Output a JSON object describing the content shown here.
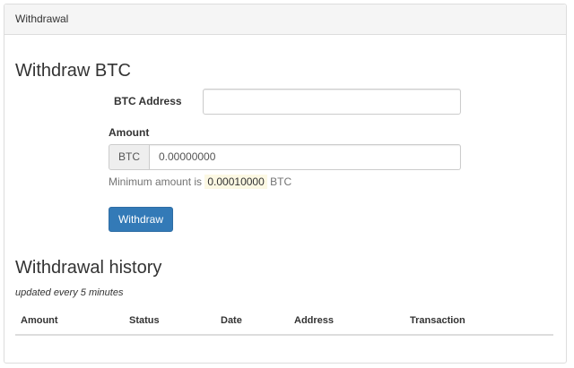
{
  "panel": {
    "heading": "Withdrawal"
  },
  "withdraw": {
    "title": "Withdraw BTC",
    "address_label": "BTC Address",
    "address_value": "",
    "amount_label": "Amount",
    "currency_addon": "BTC",
    "amount_value": "0.00000000",
    "min_prefix": "Minimum amount is",
    "min_amount": "0.00010000",
    "min_suffix": "BTC",
    "submit_label": "Withdraw"
  },
  "history": {
    "title": "Withdrawal history",
    "subtitle": "updated every 5 minutes",
    "columns": [
      "Amount",
      "Status",
      "Date",
      "Address",
      "Transaction"
    ],
    "rows": []
  },
  "colors": {
    "primary": "#337ab7",
    "highlight": "#fcf8e3"
  }
}
